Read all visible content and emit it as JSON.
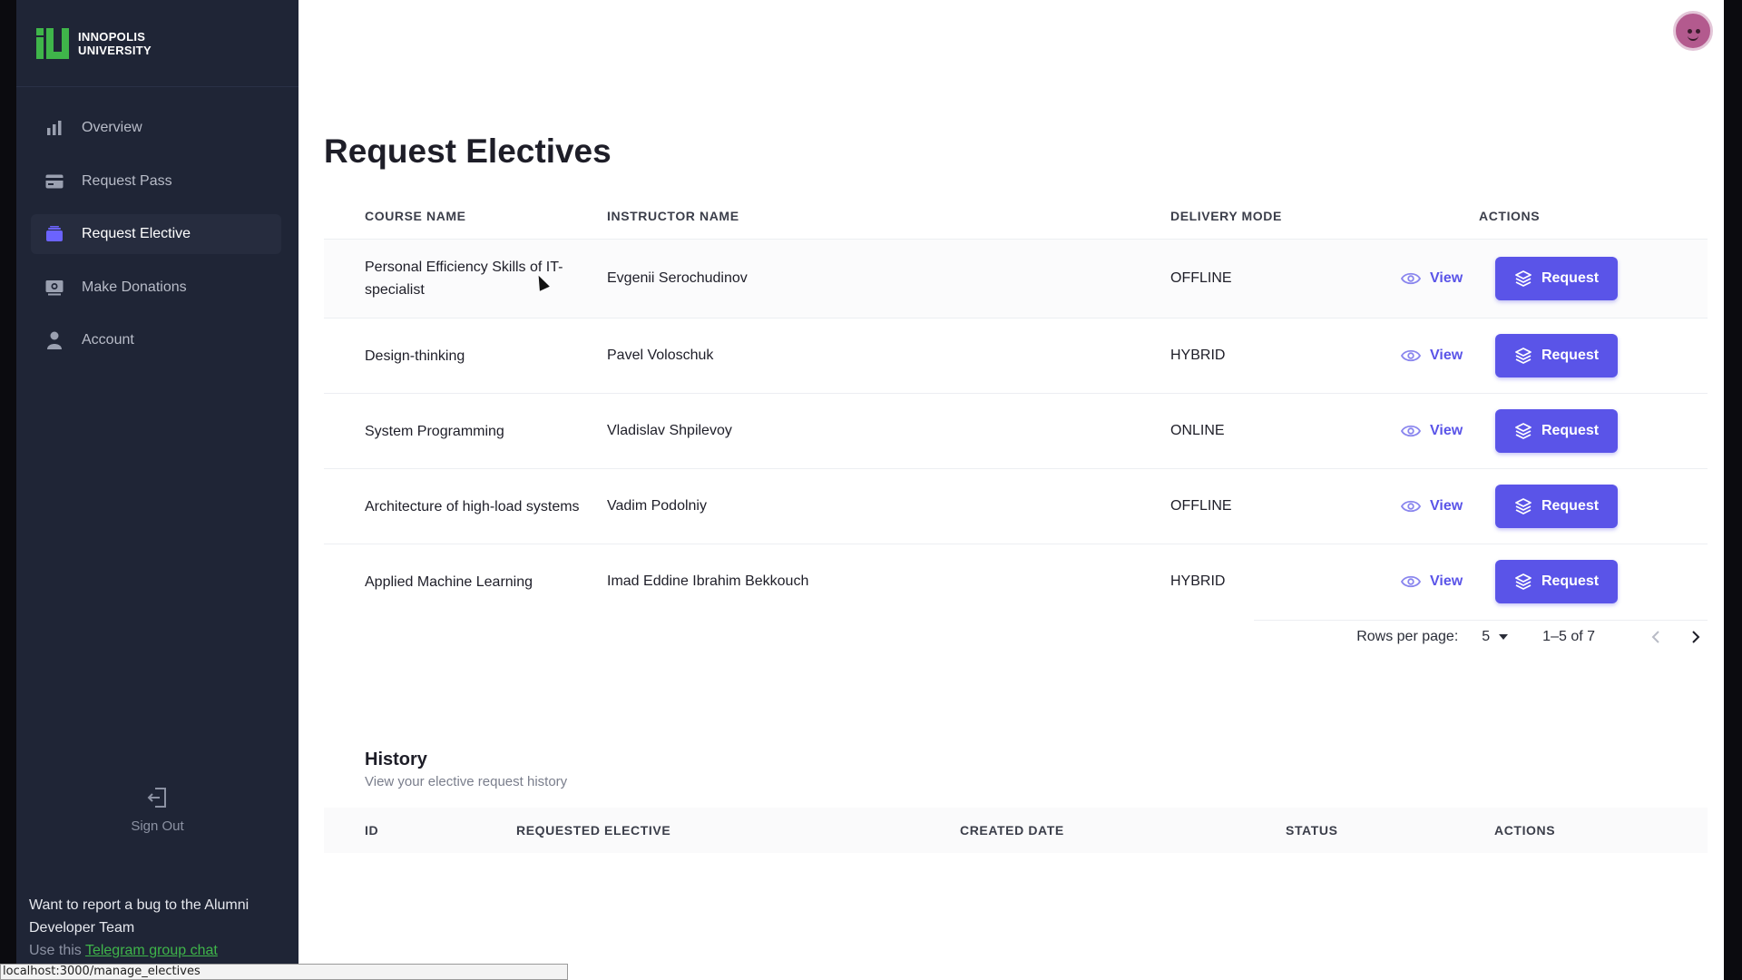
{
  "brand": {
    "line1": "INNOPOLIS",
    "line2": "UNIVERSITY",
    "color": "#3fb54a"
  },
  "sidebar": {
    "items": [
      {
        "label": "Overview",
        "icon": "bar-chart-icon"
      },
      {
        "label": "Request Pass",
        "icon": "card-icon"
      },
      {
        "label": "Request Elective",
        "icon": "layers-icon",
        "active": true
      },
      {
        "label": "Make Donations",
        "icon": "donation-icon"
      },
      {
        "label": "Account",
        "icon": "person-icon"
      }
    ],
    "sign_out": "Sign Out",
    "bug_text": "Want to report a bug to the Alumni Developer Team",
    "bug_prefix": "Use this",
    "bug_link": "Telegram group chat"
  },
  "statusbar": "localhost:3000/manage_electives",
  "page": {
    "title": "Request Electives"
  },
  "table": {
    "headers": [
      "COURSE NAME",
      "INSTRUCTOR NAME",
      "DELIVERY MODE",
      "ACTIONS"
    ],
    "rows": [
      {
        "course": "Personal Efficiency Skills of IT-specialist",
        "instructor": "Evgenii Serochudinov",
        "mode": "OFFLINE"
      },
      {
        "course": "Design-thinking",
        "instructor": "Pavel Voloschuk",
        "mode": "HYBRID"
      },
      {
        "course": "System Programming",
        "instructor": "Vladislav Shpilevoy",
        "mode": "ONLINE"
      },
      {
        "course": "Architecture of high-load systems",
        "instructor": "Vadim Podolniy",
        "mode": "OFFLINE"
      },
      {
        "course": "Applied Machine Learning",
        "instructor": "Imad Eddine Ibrahim Bekkouch",
        "mode": "HYBRID"
      }
    ],
    "view_label": "View",
    "request_label": "Request",
    "accent": "#5a54e8"
  },
  "pagination": {
    "rows_per_page_label": "Rows per page:",
    "rows_per_page": "5",
    "range": "1–5 of 7"
  },
  "history": {
    "title": "History",
    "subtitle": "View your elective request history",
    "headers": [
      "ID",
      "REQUESTED ELECTIVE",
      "CREATED DATE",
      "STATUS",
      "ACTIONS"
    ]
  }
}
